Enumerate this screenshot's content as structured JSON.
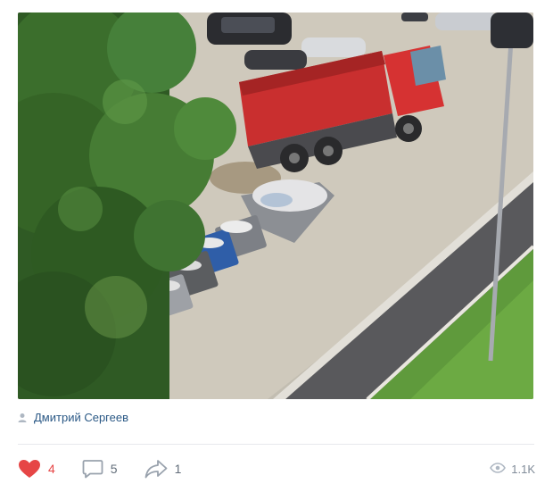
{
  "post": {
    "author": "Дмитрий Сергеев",
    "likes": "4",
    "comments": "5",
    "shares": "1",
    "views": "1.1K"
  },
  "icons": {
    "author": "user-icon",
    "like": "heart-icon",
    "comment": "comment-icon",
    "share": "share-icon",
    "views": "eye-icon"
  },
  "colors": {
    "like_active": "#e64646",
    "link": "#2a5885",
    "muted": "#818c99"
  }
}
